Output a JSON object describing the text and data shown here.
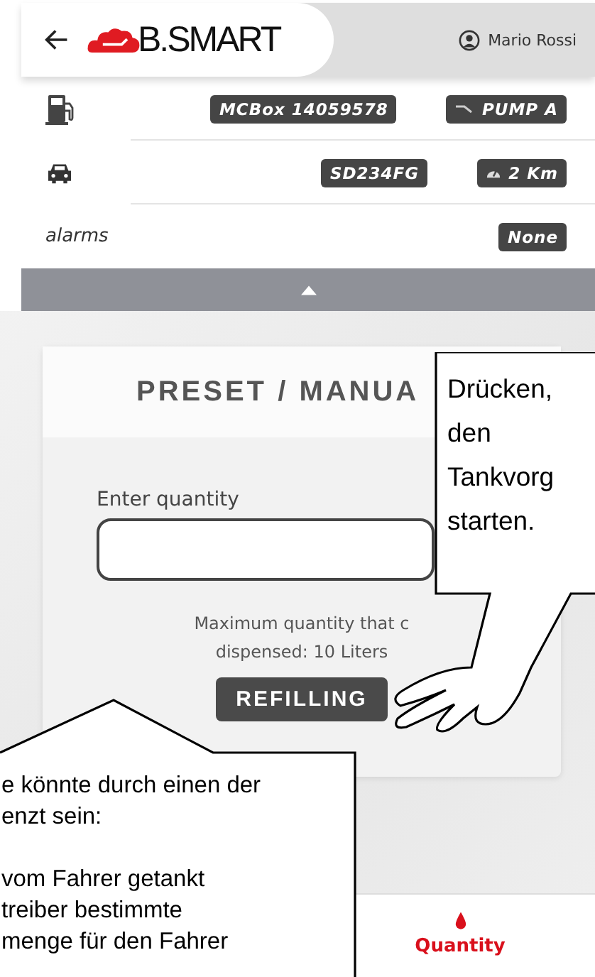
{
  "header": {
    "logo_text": "B.SMART",
    "user_name": "Mario Rossi"
  },
  "info_rows": [
    {
      "kind": "pump",
      "badges": [
        {
          "text": "MCBox 14059578"
        },
        {
          "text": "PUMP A",
          "kind": "nozzle"
        }
      ]
    },
    {
      "kind": "vehicle",
      "badges": [
        {
          "text": "SD234FG"
        },
        {
          "text": "2 Km",
          "kind": "gauge"
        }
      ]
    },
    {
      "kind": "alarms",
      "label": "alarms",
      "badges": [
        {
          "text": "None"
        }
      ]
    }
  ],
  "card": {
    "title": "PRESET / MANUA",
    "field_label": "Enter quantity",
    "note": "Maximum quantity that c\ndispensed: 10 Liters",
    "button": "REFILLING"
  },
  "tabs": [
    {
      "label": "Quantity",
      "kind": "drop",
      "selected": true
    }
  ],
  "callouts": [
    {
      "kind": "hand",
      "text": "Drücken,\nden\nTankvorg\nstarten."
    },
    {
      "kind": "speech",
      "text": "e könnte durch einen der\nenzt sein:\n\nvom Fahrer getankt\ntreiber bestimmte\nmenge für den Fahrer"
    }
  ]
}
